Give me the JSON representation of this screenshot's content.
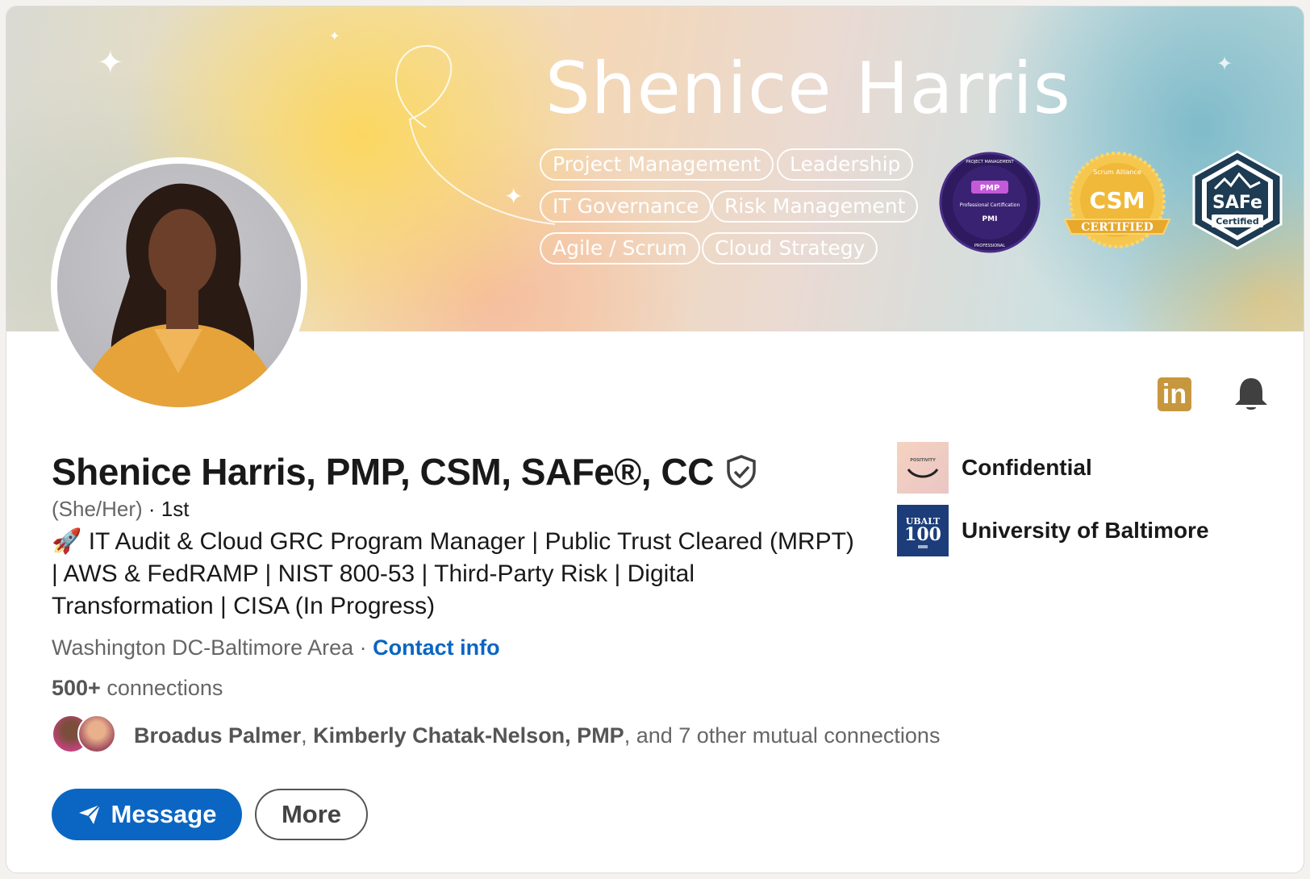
{
  "banner": {
    "title": "Shenice Harris",
    "skills": [
      "Project Management",
      "Leadership",
      "IT Governance",
      "Risk Management",
      "Agile / Scrum",
      "Cloud Strategy"
    ],
    "badges": {
      "pmp": {
        "label": "PMP",
        "sub": "Professional Certification",
        "ring_top": "PROJECT MANAGEMENT",
        "ring_bottom": "PROFESSIONAL",
        "logo": "PMI"
      },
      "csm": {
        "label": "CSM",
        "ring": "Scrum Alliance",
        "ribbon": "CERTIFIED"
      },
      "safe": {
        "label": "SAFe",
        "sub": "Certified"
      }
    },
    "colors": {
      "pmp_bg": "#2e1a5e",
      "csm_gold": "#f0b93a",
      "safe_navy": "#1d3b52"
    }
  },
  "profile": {
    "name": "Shenice Harris, PMP, CSM, SAFe®, CC",
    "pronouns": "(She/Her)",
    "degree": " · 1st",
    "headline": "🚀 IT Audit & Cloud GRC Program Manager | Public Trust Cleared (MRPT) | AWS & FedRAMP | NIST 800-53 | Third-Party Risk | Digital Transformation | CISA (In Progress)",
    "location": "Washington DC-Baltimore Area",
    "location_sep": " · ",
    "contact_link": "Contact info",
    "connections_count": "500+",
    "connections_label": " connections",
    "mutual": {
      "name1": "Broadus Palmer",
      "sep1": ", ",
      "name2": "Kimberly Chatak-Nelson, PMP",
      "rest": ", and 7 other mutual connections"
    }
  },
  "actions": {
    "message_label": "Message",
    "more_label": "More",
    "linkedin_icon_text": "in"
  },
  "orgs": [
    {
      "name": "Confidential",
      "logo_text": "POSITIVITY"
    },
    {
      "name": "University of Baltimore",
      "logo_text_top": "UBALT",
      "logo_text_big": "100"
    }
  ],
  "theme": {
    "accent": "#0a66c2",
    "linkedin_gold": "#c7973f"
  }
}
